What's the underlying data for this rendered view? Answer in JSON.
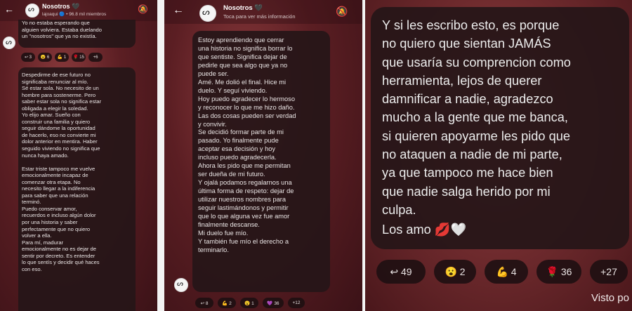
{
  "channel": {
    "name": "Nosotros 🖤",
    "handle_line": "lajoaqui 🔵 • 96.8 mil miembros",
    "subtitle": "Toca para ver más información"
  },
  "icons": {
    "back": "back-arrow-icon",
    "mute": "mute-bell-icon",
    "avatar": "channel-avatar-icon"
  },
  "panel1": {
    "msg1": "Yo no estaba esperando que\nalguien volviera. Estaba duelando\nun \"nosotros\" que ya no existía.",
    "msg1_reactions": [
      "↩ 3",
      "😮 6",
      "💪 1",
      "🌹 15",
      "+6"
    ],
    "msg2": "Despedirme de ese futuro no\nsignificaba renunciar al mío.\nSé estar sola. No necesito de un\nhombre para sostenerme. Pero\nsaber estar sola no significa estar\nobligada a elegir la soledad.\nYo elijo amar. Sueño con\nconstruir una familia y quiero\nseguir dándome la oportunidad\nde hacerlo, eso no convierte mi\ndolor anterior en mentira. Haber\nseguido viviendo no significa que\nnunca haya amado.\n\nEstar triste tampoco me vuelve\nemocionalmente incapaz de\ncomenzar otra etapa. No\nnecesito llegar a la indiferencia\npara saber que una relación\nterminó.\nPuedo conservar amor,\nrecuerdos e incluso algún dolor\npor una historia y saber\nperfectamente que no quiero\nvolver a ella.\nPara mí, madurar\nemocionalmente no es dejar de\nsentir por decreto. Es entender\nlo que sentís y decidir qué haces\ncon eso."
  },
  "panel2": {
    "msg": "Estoy aprendiendo que cerrar\nuna historia no significa borrar lo\nque sentiste. Significa dejar de\npedirle que sea algo que ya no\npuede ser.\nAmé. Me dolió el final. Hice mi\nduelo. Y seguí viviendo.\nHoy puedo agradecer lo hermoso\ny reconocer lo que me hizo daño.\nLas dos cosas pueden ser verdad\ny convivir.\nSe decidió formar parte de mi\npasado. Yo finalmente pude\naceptar esa decisión y hoy\nincluso puedo agradecerla.\nAhora les pido que me permitan\nser dueña de mi futuro.\nY ojalá podamos regalarnos una\núltima forma de respeto: dejar de\nutilizar nuestros nombres para\nseguir lastimándonos y permitir\nque lo que alguna vez fue amor\nfinalmente descanse.\nMi duelo fue mío.\nY también fue mío el derecho a\nterminarlo.",
    "reactions": [
      "↩ 8",
      "💪 2",
      "😮 1",
      "💜 36",
      "+12"
    ]
  },
  "panel3": {
    "msg": "Y si les escribo esto, es porque\nno quiero que sientan JAMÁS\nque usaría su comprencion como\nherramienta, lejos de querer\ndamnificar a nadie, agradezco\nmucho a la gente que me banca,\nsi quieren apoyarme les pido que\nno ataquen a nadie de mi parte,\nya que tampoco me hace bien\nque nadie salga herido por mi\nculpa.",
    "signoff": " Los amo 💋🤍",
    "reactions": [
      "↩ 49",
      "😮 2",
      "💪 4",
      "🌹 36",
      "+27"
    ],
    "seen": "Visto po"
  }
}
